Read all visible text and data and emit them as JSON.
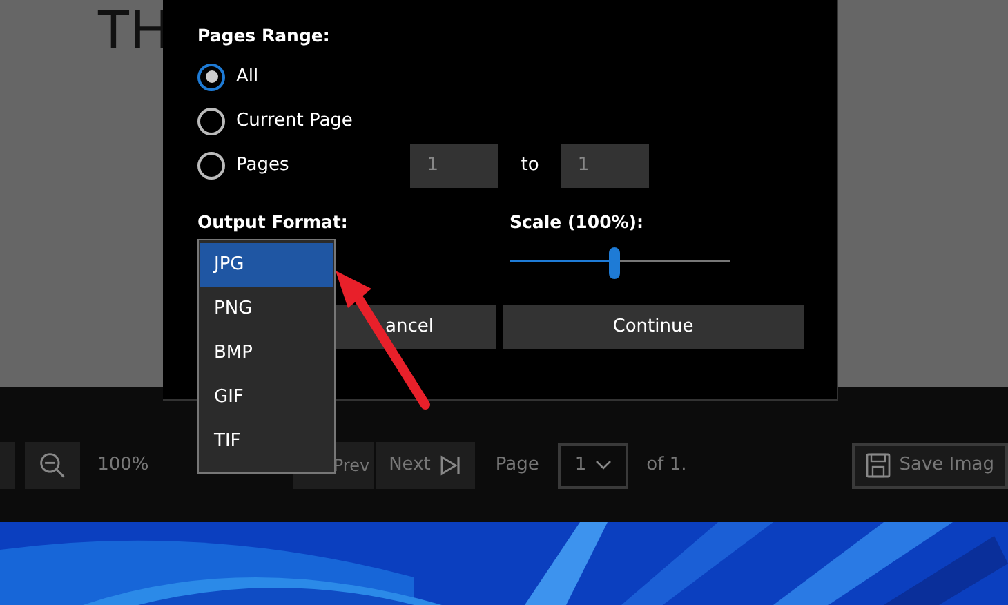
{
  "document": {
    "heading": "TH"
  },
  "dialog": {
    "pages_range_label": "Pages Range:",
    "range_options": [
      {
        "label": "All",
        "selected": true
      },
      {
        "label": "Current Page",
        "selected": false
      },
      {
        "label": "Pages",
        "selected": false
      }
    ],
    "page_from": "1",
    "to_label": "to",
    "page_to": "1",
    "output_format_label": "Output Format:",
    "format_options": [
      {
        "label": "JPG",
        "selected": true
      },
      {
        "label": "PNG",
        "selected": false
      },
      {
        "label": "BMP",
        "selected": false
      },
      {
        "label": "GIF",
        "selected": false
      },
      {
        "label": "TIF",
        "selected": false
      }
    ],
    "scale_label": "Scale (100%):",
    "scale": {
      "level": 0.475
    },
    "buttons": [
      {
        "label": "ancel"
      },
      {
        "label": "Continue"
      }
    ]
  },
  "toolbar": {
    "zoom_value": "100%",
    "prev_label": "Prev",
    "next_label": "Next",
    "page_label": "Page",
    "page_value": "1",
    "page_count": "of 1.",
    "save_label": "Save Imag"
  }
}
